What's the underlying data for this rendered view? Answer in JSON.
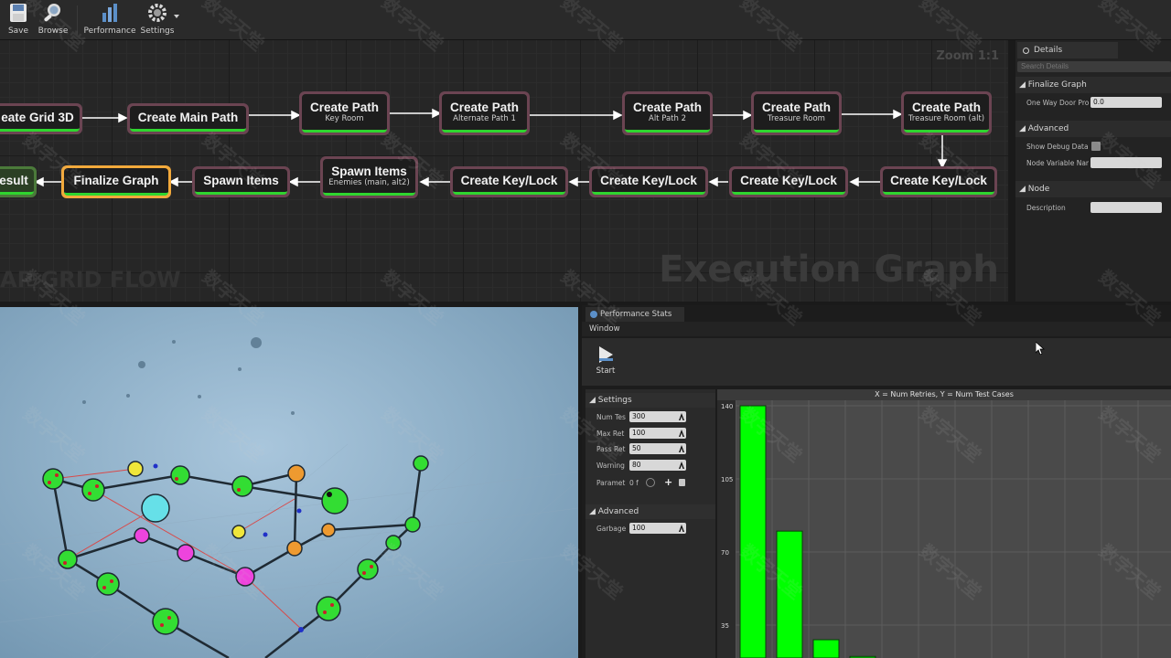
{
  "toolbar": {
    "items": [
      {
        "label": "Save",
        "icon": "save-icon"
      },
      {
        "label": "Browse",
        "icon": "browse-icon"
      },
      {
        "label": "Performance",
        "icon": "performance-icon"
      },
      {
        "label": "Settings",
        "icon": "settings-icon"
      }
    ]
  },
  "graph": {
    "zoom": "Zoom 1:1",
    "title": "Execution Graph",
    "watermark_label": "AP GRID FLOW",
    "nodes": [
      {
        "title": "eate Grid 3D",
        "subtitle": ""
      },
      {
        "title": "Create Main Path",
        "subtitle": ""
      },
      {
        "title": "Create Path",
        "subtitle": "Key Room"
      },
      {
        "title": "Create Path",
        "subtitle": "Alternate Path 1"
      },
      {
        "title": "Create Path",
        "subtitle": "Alt Path 2"
      },
      {
        "title": "Create Path",
        "subtitle": "Treasure Room"
      },
      {
        "title": "Create Path",
        "subtitle": "Treasure Room (alt)"
      },
      {
        "title": "Create Key/Lock",
        "subtitle": ""
      },
      {
        "title": "Create Key/Lock",
        "subtitle": ""
      },
      {
        "title": "Create Key/Lock",
        "subtitle": ""
      },
      {
        "title": "Create Key/Lock",
        "subtitle": ""
      },
      {
        "title": "Spawn Items",
        "subtitle": "Enemies (main, alt2)"
      },
      {
        "title": "Spawn Items",
        "subtitle": ""
      },
      {
        "title": "Finalize Graph",
        "subtitle": ""
      },
      {
        "title": "esult",
        "subtitle": ""
      }
    ]
  },
  "details": {
    "tab": "Details",
    "search_placeholder": "Search Details",
    "sections": [
      {
        "title": "Finalize Graph",
        "rows": [
          {
            "key": "One Way Door Prob",
            "value": "0.0"
          }
        ]
      },
      {
        "title": "Advanced",
        "rows": [
          {
            "key": "Show Debug Data",
            "value": ""
          },
          {
            "key": "Node Variable Nam",
            "value": ""
          }
        ]
      },
      {
        "title": "Node",
        "rows": [
          {
            "key": "Description",
            "value": ""
          }
        ]
      }
    ]
  },
  "perf": {
    "tab": "Performance Stats",
    "menu": "Window",
    "start_label": "Start",
    "settings_title": "Settings",
    "settings": [
      {
        "key": "Num Tes",
        "value": "300"
      },
      {
        "key": "Max Ret",
        "value": "100"
      },
      {
        "key": "Pass Ret",
        "value": "50"
      },
      {
        "key": "Warning",
        "value": "80"
      },
      {
        "key": "Paramet",
        "value": "0 f"
      }
    ],
    "advanced_title": "Advanced",
    "advanced": [
      {
        "key": "Garbage",
        "value": "100"
      }
    ]
  },
  "chart_data": {
    "type": "bar",
    "title": "X = Num Retries, Y = Num Test Cases",
    "ylim": [
      0,
      140
    ],
    "yticks": [
      "140",
      "105",
      "70",
      "35"
    ],
    "values": [
      140,
      80,
      28,
      20
    ],
    "grid": true,
    "bar_color": "#00ff00"
  },
  "watermark": "数字天堂"
}
